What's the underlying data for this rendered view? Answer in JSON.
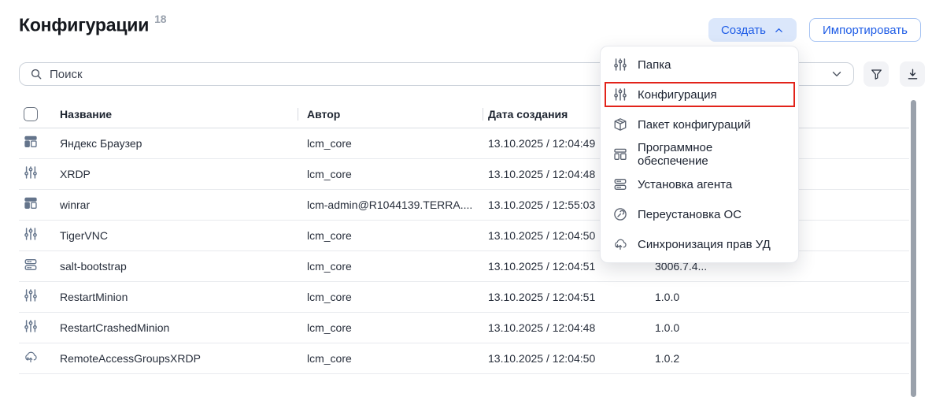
{
  "page": {
    "title": "Конфигурации",
    "count": "18"
  },
  "toolbar": {
    "create_label": "Создать",
    "create_icon": "chevron-up-icon",
    "import_label": "Импортировать"
  },
  "search": {
    "placeholder": "Поиск",
    "icons": [
      "search-icon",
      "chevron-down-icon",
      "filter-icon",
      "download-icon"
    ]
  },
  "menu": {
    "items": [
      {
        "icon": "sliders-icon",
        "label": "Папка",
        "highlighted": false
      },
      {
        "icon": "sliders-icon",
        "label": "Конфигурация",
        "highlighted": true
      },
      {
        "icon": "package-icon",
        "label": "Пакет конфигураций",
        "highlighted": false
      },
      {
        "icon": "software-icon",
        "label": "Программное обеспечение",
        "highlighted": false
      },
      {
        "icon": "server-icon",
        "label": "Установка агента",
        "highlighted": false
      },
      {
        "icon": "wrench-circle-icon",
        "label": "Переустановка ОС",
        "highlighted": false
      },
      {
        "icon": "cloud-sync-icon",
        "label": "Синхронизация прав УД",
        "highlighted": false
      }
    ]
  },
  "table": {
    "columns": [
      "Название",
      "Автор",
      "Дата создания"
    ],
    "rows": [
      {
        "icon": "software-icon",
        "name": "Яндекс Браузер",
        "author": "lcm_core",
        "created": "13.10.2025 / 12:04:49",
        "version": ""
      },
      {
        "icon": "sliders-icon",
        "name": "XRDP",
        "author": "lcm_core",
        "created": "13.10.2025 / 12:04:48",
        "version": ""
      },
      {
        "icon": "software-icon",
        "name": "winrar",
        "author": "lcm-admin@R1044139.TERRA....",
        "created": "13.10.2025 / 12:55:03",
        "version": ""
      },
      {
        "icon": "sliders-icon",
        "name": "TigerVNC",
        "author": "lcm_core",
        "created": "13.10.2025 / 12:04:50",
        "version": ""
      },
      {
        "icon": "server-icon",
        "name": "salt-bootstrap",
        "author": "lcm_core",
        "created": "13.10.2025 / 12:04:51",
        "version": "3006.7.4..."
      },
      {
        "icon": "sliders-icon",
        "name": "RestartMinion",
        "author": "lcm_core",
        "created": "13.10.2025 / 12:04:51",
        "version": "1.0.0"
      },
      {
        "icon": "sliders-icon",
        "name": "RestartCrashedMinion",
        "author": "lcm_core",
        "created": "13.10.2025 / 12:04:48",
        "version": "1.0.0"
      },
      {
        "icon": "cloud-sync-icon",
        "name": "RemoteAccessGroupsXRDP",
        "author": "lcm_core",
        "created": "13.10.2025 / 12:04:50",
        "version": "1.0.2"
      }
    ]
  },
  "colors": {
    "accent_blue": "#1e5ce6",
    "create_button_bg": "#dbe7fb",
    "highlight_red": "#e2231a",
    "icon_slate": "#64748b"
  }
}
